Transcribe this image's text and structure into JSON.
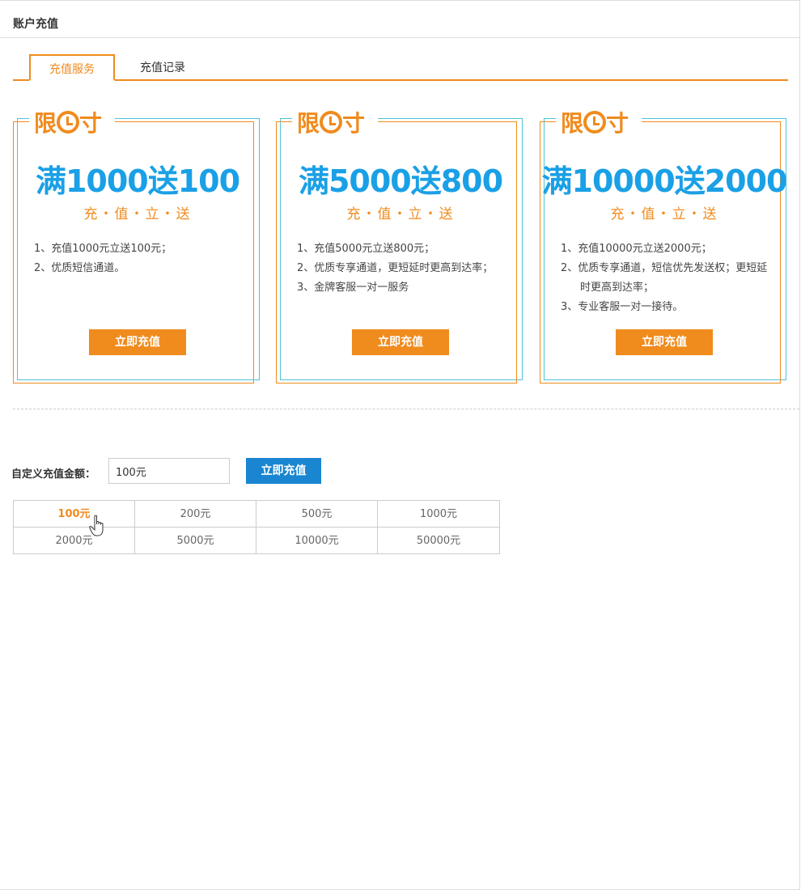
{
  "header": {
    "title": "账户充值"
  },
  "tabs": [
    {
      "label": "充值服务",
      "active": true
    },
    {
      "label": "充值记录",
      "active": false
    }
  ],
  "packages": [
    {
      "badge": "限时",
      "headline": "满1000送100",
      "tagline": "充・值・立・送",
      "items": [
        "1、充值1000元立送100元；",
        "2、优质短信通道。"
      ],
      "button": "立即充值"
    },
    {
      "badge": "限时",
      "headline": "满5000送800",
      "tagline": "充・值・立・送",
      "items": [
        "1、充值5000元立送800元；",
        "2、优质专享通道，更短延时更高到达率；",
        "3、金牌客服一对一服务"
      ],
      "button": "立即充值"
    },
    {
      "badge": "限时",
      "headline": "满10000送2000",
      "tagline": "充・值・立・送",
      "items": [
        "1、充值10000元立送2000元；",
        "2、优质专享通道，短信优先发送权；更短延时更高到达率；",
        "3、专业客服一对一接待。"
      ],
      "button": "立即充值"
    }
  ],
  "custom": {
    "label": "自定义充值金额：",
    "input_value": "100元",
    "button": "立即充值"
  },
  "amounts": [
    "100元",
    "200元",
    "500元",
    "1000元",
    "2000元",
    "5000元",
    "10000元",
    "50000元"
  ],
  "selected_amount": "100元",
  "colors": {
    "accent": "#f08b1d",
    "blue": "#1aa0e6",
    "button_blue": "#1a86d1"
  }
}
